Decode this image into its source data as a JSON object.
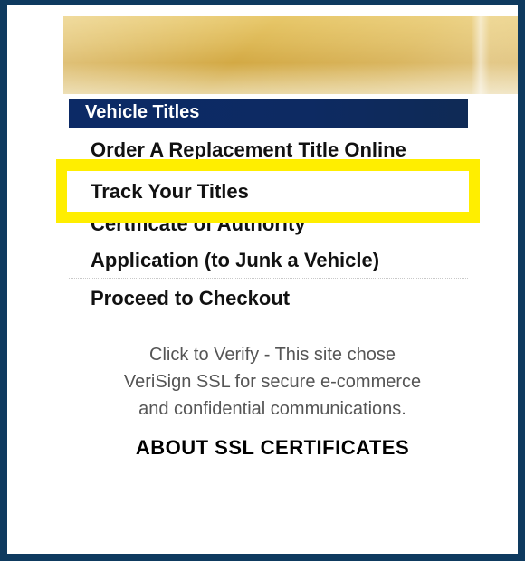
{
  "menu": {
    "section_title": "Vehicle Titles",
    "items": [
      {
        "label": "Order A Replacement Title Online"
      },
      {
        "label": "Track Your Titles"
      },
      {
        "label_line1": "Certificate of Authority",
        "label_line2": "Application (to Junk a Vehicle)"
      },
      {
        "label": "Proceed to Checkout"
      }
    ],
    "highlighted_index": 1
  },
  "verisign": {
    "text_line1": "Click to Verify - This site chose",
    "text_line2": "VeriSign SSL for secure e-commerce",
    "text_line3": "and confidential communications.",
    "about_link": "ABOUT SSL CERTIFICATES"
  },
  "colors": {
    "frame_border": "#0e3a5f",
    "header_bg": "#0c2a66",
    "highlight": "#ffee00",
    "banner_gold": "#ddb856"
  }
}
